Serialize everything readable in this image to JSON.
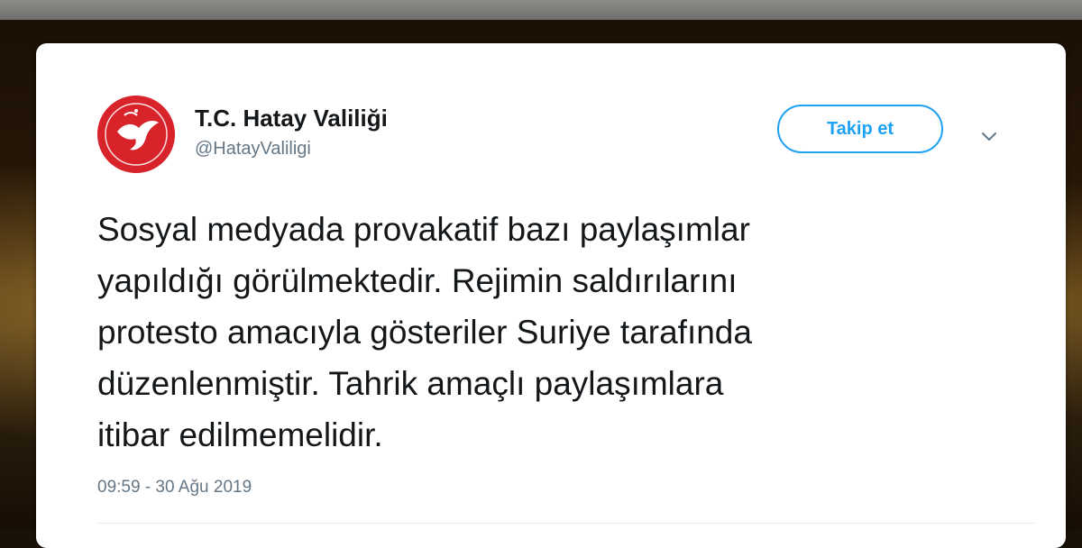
{
  "tweet": {
    "author_name": "T.C. Hatay Valiliği",
    "author_handle": "@HatayValiligi",
    "follow_label": "Takip et",
    "text_lines": [
      "Sosyal medyada provakatif bazı paylaşımlar",
      "yapıldığı görülmektedir. Rejimin saldırılarını",
      "protesto amacıyla gösteriler Suriye tarafında",
      "düzenlenmiştir. Tahrik amaçlı paylaşımlara",
      "itibar edilmemelidir."
    ],
    "timestamp": "09:59 - 30 Ağu 2019"
  },
  "icons": {
    "avatar": "hatay-valiligi-logo",
    "menu": "chevron-down-icon"
  },
  "colors": {
    "accent": "#1da1f2",
    "text": "#14171a",
    "secondary_text": "#657786",
    "logo_red": "#d8232a"
  }
}
